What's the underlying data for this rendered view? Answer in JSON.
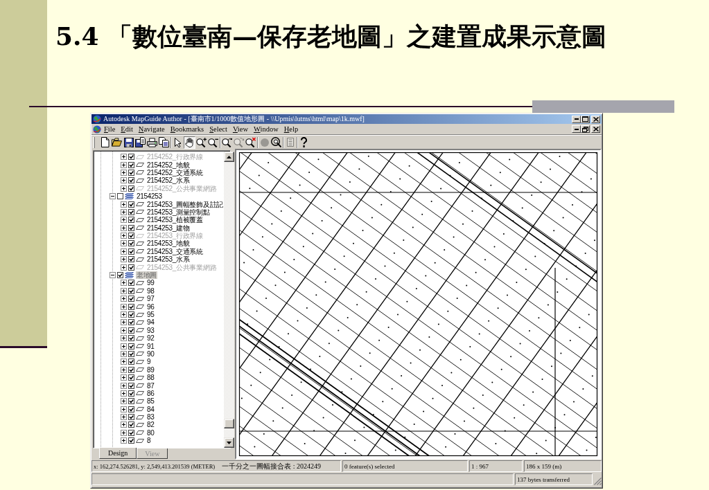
{
  "slide": {
    "title": "5.4 「數位臺南—保存老地圖」之建置成果示意圖"
  },
  "window": {
    "title": "Autodesk MapGuide Author - [臺南市1/1000數值地形圖 - \\\\Upmis\\lutms\\html\\map\\1k.mwf]"
  },
  "menu": [
    "File",
    "Edit",
    "Navigate",
    "Bookmarks",
    "Select",
    "View",
    "Window",
    "Help"
  ],
  "toolbar": [
    {
      "kind": "button",
      "pressed": false,
      "disabled": false
    },
    {
      "kind": "button",
      "pressed": false,
      "disabled": false
    },
    {
      "kind": "button",
      "pressed": false,
      "disabled": false
    },
    {
      "kind": "button",
      "pressed": false,
      "disabled": false
    },
    {
      "kind": "button",
      "pressed": false,
      "disabled": false
    },
    {
      "kind": "button",
      "pressed": false,
      "disabled": false
    },
    {
      "kind": "separator"
    },
    {
      "kind": "button",
      "pressed": false,
      "disabled": false
    },
    {
      "kind": "button",
      "pressed": true,
      "disabled": false
    },
    {
      "kind": "button",
      "pressed": false,
      "disabled": false
    },
    {
      "kind": "button",
      "pressed": false,
      "disabled": false
    },
    {
      "kind": "separator"
    },
    {
      "kind": "button",
      "pressed": false,
      "disabled": false
    },
    {
      "kind": "button",
      "pressed": false,
      "disabled": true
    },
    {
      "kind": "button",
      "pressed": false,
      "disabled": false
    },
    {
      "kind": "separator"
    },
    {
      "kind": "button",
      "pressed": false,
      "disabled": true
    },
    {
      "kind": "button",
      "pressed": false,
      "disabled": false
    },
    {
      "kind": "separator"
    },
    {
      "kind": "button",
      "pressed": false,
      "disabled": true
    },
    {
      "kind": "separator"
    },
    {
      "kind": "button",
      "pressed": false,
      "disabled": false
    }
  ],
  "layer_tree": {
    "groups": [
      {
        "children": [
          {
            "label": "2154252_行政界線",
            "checked": true,
            "disabled": true,
            "expanded": false,
            "selected": false
          },
          {
            "label": "2154252_地貌",
            "checked": true,
            "disabled": false,
            "expanded": false,
            "selected": false
          },
          {
            "label": "2154252_交通系統",
            "checked": true,
            "disabled": false,
            "expanded": false,
            "selected": false
          },
          {
            "label": "2154252_水系",
            "checked": true,
            "disabled": false,
            "expanded": false,
            "selected": false
          },
          {
            "label": "2154252_公共事業網路",
            "checked": true,
            "disabled": true,
            "expanded": false,
            "selected": false
          }
        ]
      },
      {
        "label": "2154253",
        "checked": false,
        "expanded": true,
        "selected": false,
        "children": [
          {
            "label": "2154253_圖幅整飾及註記",
            "checked": true,
            "disabled": false,
            "expanded": false,
            "selected": false
          },
          {
            "label": "2154253_測量控制點",
            "checked": true,
            "disabled": false,
            "expanded": false,
            "selected": false
          },
          {
            "label": "2154253_植被覆蓋",
            "checked": true,
            "disabled": false,
            "expanded": false,
            "selected": false
          },
          {
            "label": "2154253_建物",
            "checked": true,
            "disabled": false,
            "expanded": false,
            "selected": false
          },
          {
            "label": "2154253_行政界線",
            "checked": true,
            "disabled": true,
            "expanded": false,
            "selected": false
          },
          {
            "label": "2154253_地貌",
            "checked": true,
            "disabled": false,
            "expanded": false,
            "selected": false
          },
          {
            "label": "2154253_交通系統",
            "checked": true,
            "disabled": false,
            "expanded": false,
            "selected": false
          },
          {
            "label": "2154253_水系",
            "checked": true,
            "disabled": false,
            "expanded": false,
            "selected": false
          },
          {
            "label": "2154253_公共事業網路",
            "checked": true,
            "disabled": true,
            "expanded": false,
            "selected": false
          }
        ]
      },
      {
        "label": "老地圖",
        "checked": true,
        "expanded": true,
        "selected": true,
        "children": [
          {
            "label": "99",
            "checked": true,
            "disabled": false,
            "expanded": false,
            "selected": false
          },
          {
            "label": "98",
            "checked": true,
            "disabled": false,
            "expanded": false,
            "selected": false
          },
          {
            "label": "97",
            "checked": true,
            "disabled": false,
            "expanded": false,
            "selected": false
          },
          {
            "label": "96",
            "checked": true,
            "disabled": false,
            "expanded": false,
            "selected": false
          },
          {
            "label": "95",
            "checked": true,
            "disabled": false,
            "expanded": false,
            "selected": false
          },
          {
            "label": "94",
            "checked": true,
            "disabled": false,
            "expanded": false,
            "selected": false
          },
          {
            "label": "93",
            "checked": true,
            "disabled": false,
            "expanded": false,
            "selected": false
          },
          {
            "label": "92",
            "checked": true,
            "disabled": false,
            "expanded": false,
            "selected": false
          },
          {
            "label": "91",
            "checked": true,
            "disabled": false,
            "expanded": false,
            "selected": false
          },
          {
            "label": "90",
            "checked": true,
            "disabled": false,
            "expanded": false,
            "selected": false
          },
          {
            "label": "9",
            "checked": true,
            "disabled": false,
            "expanded": false,
            "selected": false
          },
          {
            "label": "89",
            "checked": true,
            "disabled": false,
            "expanded": false,
            "selected": false
          },
          {
            "label": "88",
            "checked": true,
            "disabled": false,
            "expanded": false,
            "selected": false
          },
          {
            "label": "87",
            "checked": true,
            "disabled": false,
            "expanded": false,
            "selected": false
          },
          {
            "label": "86",
            "checked": true,
            "disabled": false,
            "expanded": false,
            "selected": false
          },
          {
            "label": "85",
            "checked": true,
            "disabled": false,
            "expanded": false,
            "selected": false
          },
          {
            "label": "84",
            "checked": true,
            "disabled": false,
            "expanded": false,
            "selected": false
          },
          {
            "label": "83",
            "checked": true,
            "disabled": false,
            "expanded": false,
            "selected": false
          },
          {
            "label": "82",
            "checked": true,
            "disabled": false,
            "expanded": false,
            "selected": false
          },
          {
            "label": "80",
            "checked": true,
            "disabled": false,
            "expanded": false,
            "selected": false
          },
          {
            "label": "8",
            "checked": true,
            "disabled": false,
            "expanded": false,
            "selected": false
          }
        ]
      }
    ]
  },
  "panel_tabs": [
    {
      "label": "Design",
      "selected": true,
      "disabled": false
    },
    {
      "label": "View",
      "selected": false,
      "disabled": true
    }
  ],
  "status_bar": {
    "coordinates": "x: 162,274.526281, y: 2,549,413.201539 (METER)",
    "map_sheet": "一千分之一圖幅接合表 : 2024249",
    "selection": "0 feature(s) selected",
    "scale": "1 : 967",
    "extent": "186 x 159 (m)",
    "transfer": "137 bytes transferred"
  }
}
